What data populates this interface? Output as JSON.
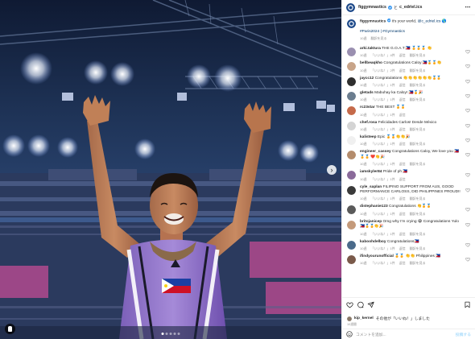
{
  "header": {
    "username": "figgymnastics",
    "separator": "と",
    "collaborator": "c_edriel.ics",
    "more_icon": "⋯"
  },
  "caption": {
    "username": "figgymnastics",
    "text": "It's your world,",
    "mention": "@c_edriel.ics",
    "emoji": "🌎",
    "hashtags": "#Paris2024 | #Gymnastics",
    "time": "10週",
    "translation": "翻訳を見る"
  },
  "comments": [
    {
      "user": "arki.taktura",
      "text": "THE G.O.A.T 🇵🇭 🏅🏅🏅 👏",
      "meta": [
        "10週",
        "「いいね！」4件",
        "返信",
        "翻訳を見る"
      ],
      "color": "#9a8fb0"
    },
    {
      "user": "bellbeaqkho",
      "text": "Congratulations Caloy 🇵🇭🏅🏅👏",
      "meta": [
        "10週",
        "「いいね！」2件",
        "返信",
        "翻訳を見る"
      ],
      "color": "#c8a489"
    },
    {
      "user": "jaycc12",
      "text": "Congratulations 👏👏👏👏👏👏🏅🏅",
      "meta": [
        "10週",
        "「いいね！」1件",
        "返信",
        "翻訳を見る"
      ],
      "color": "#2e2e2e"
    },
    {
      "user": "gletads",
      "text": "Mabuhay ka Caloy! 🇵🇭🏅🎉",
      "meta": [
        "10週",
        "「いいね！」1件",
        "返信",
        "翻訳を見る"
      ],
      "color": "#6b7d8f"
    },
    {
      "user": "rc23star",
      "text": "THE BEST 🏅🏅",
      "meta": [
        "10週",
        "「いいね！」1件",
        "返信"
      ],
      "color": "#c56a4a"
    },
    {
      "user": "chef.rosa",
      "text": "Felicidades Carlos! Desde México",
      "meta": [
        "10週",
        "「いいね！」1件",
        "返信",
        "翻訳を見る"
      ],
      "color": "#d4d4d4"
    },
    {
      "user": "kalisteep",
      "text": "Epic 🏅🏅👏👏🎉",
      "meta": [
        "10週",
        "「いいね！」1件",
        "返信",
        "翻訳を見る"
      ],
      "color": "#f0f0f0"
    },
    {
      "user": "engineer_cassey",
      "text": "Congratulations Caloy, We love you 🇵🇭🏅🏅 ❤️👏🎉",
      "meta": [
        "10週",
        "「いいね！」1件",
        "返信",
        "翻訳を見る"
      ],
      "color": "#b48c6c"
    },
    {
      "user": "iamskyler84",
      "text": "Pride of ph 🇵🇭",
      "meta": [
        "10週",
        "「いいね！」1件",
        "返信"
      ],
      "color": "#8a6a9a"
    },
    {
      "user": "cyle_saplan",
      "text": "FILIPINO SUPPORT FROM AUS, GOOD PERFORMANCE CARLOSS, DID PHILIPPINES PROUD!!",
      "meta": [
        "10週",
        "「いいね！」1件",
        "返信",
        "翻訳を見る"
      ],
      "color": "#3a3a3a"
    },
    {
      "user": "distephanie123",
      "text": "Congratulations 👏🏅🏅",
      "meta": [
        "10週",
        "「いいね！」1件",
        "返信",
        "翻訳を見る"
      ],
      "color": "#5a5a5a"
    },
    {
      "user": "britojanicep",
      "text": "Omg why I'm crying 😭 Congratulations Yulo 🇵🇭🏅🏅👏🎉",
      "meta": [
        "10週",
        "「いいね！」1件",
        "返信",
        "翻訳を見る"
      ],
      "color": "#c49a7a"
    },
    {
      "user": "kaboohdelboy",
      "text": "Congratulations🇵🇭",
      "meta": [
        "10週",
        "「いいね！」1件",
        "返信",
        "翻訳を見る"
      ],
      "color": "#4a6a8a"
    },
    {
      "user": "ifindyourunofficial",
      "text": "🏅🏅 👏👏 Philippines 🇵🇭",
      "meta": [
        "10週",
        "「いいね！」1件",
        "返信",
        "翻訳を見る"
      ],
      "color": "#7a5a4a"
    }
  ],
  "likes": {
    "user": "kip_kernel",
    "text": "その他が「いいね！」しました"
  },
  "date": "10週間",
  "add_comment": {
    "placeholder": "コメントを追加...",
    "post_label": "投稿する"
  },
  "colors": {
    "mention": "#00376b",
    "meta": "#8e8e8e",
    "post_button": "#b2dffc",
    "verified": "#3897f0"
  }
}
